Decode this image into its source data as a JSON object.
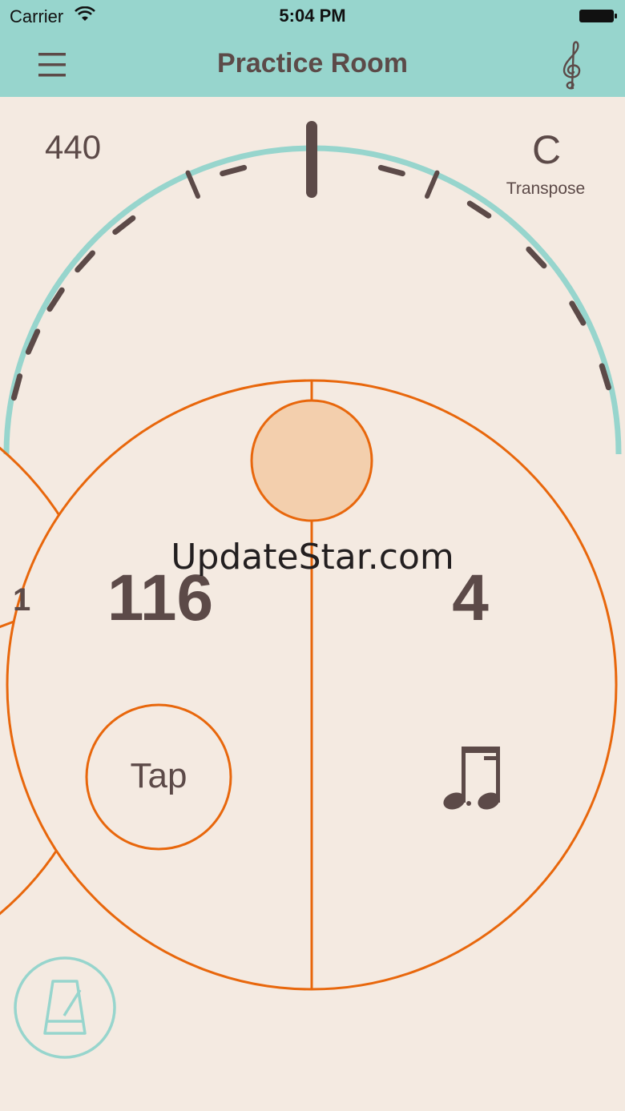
{
  "status_bar": {
    "carrier": "Carrier",
    "time": "5:04 PM"
  },
  "nav": {
    "title": "Practice Room",
    "menu_icon": "hamburger-menu-icon",
    "clef_icon": "treble-clef-icon"
  },
  "tuner": {
    "reference_frequency": "440",
    "transpose_key": "C",
    "transpose_label": "Transpose"
  },
  "metronome": {
    "bpm": "116",
    "beats": "4",
    "tap_label": "Tap",
    "subdivision_icon": "eighth-notes-icon",
    "left_partial_number": "1",
    "metronome_icon": "metronome-icon"
  },
  "watermark": "UpdateStar.com",
  "colors": {
    "header": "#97D5CD",
    "background": "#F4EAE1",
    "accent_orange": "#E8670C",
    "light_orange_fill": "#F3CFAD",
    "text_dark": "#5C4A48",
    "teal": "#97D5CD"
  }
}
